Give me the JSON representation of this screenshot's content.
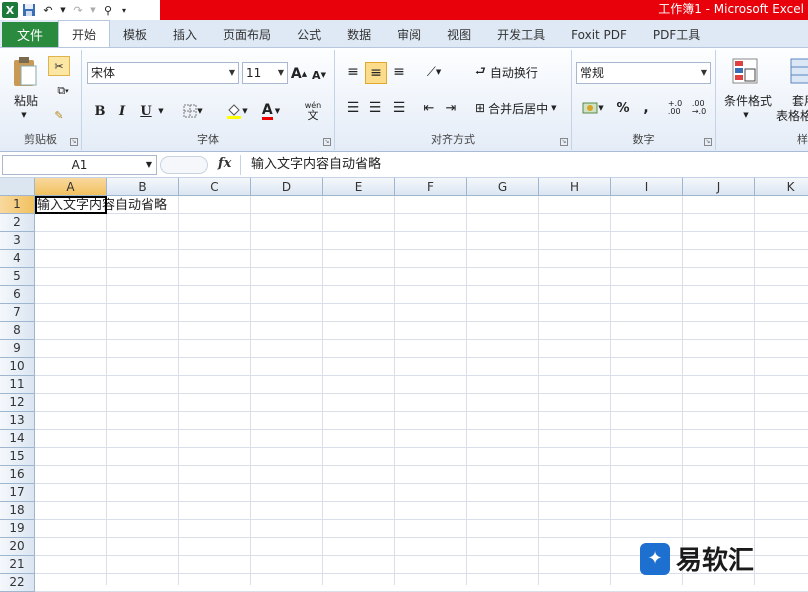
{
  "window": {
    "title": "工作簿1 - Microsoft Excel"
  },
  "ribbon_tabs": {
    "file": "文件",
    "tabs": [
      "开始",
      "模板",
      "插入",
      "页面布局",
      "公式",
      "数据",
      "审阅",
      "视图",
      "开发工具",
      "Foxit PDF",
      "PDF工具"
    ],
    "active": "开始"
  },
  "clipboard": {
    "paste": "粘贴",
    "label": "剪贴板"
  },
  "font": {
    "name": "宋体",
    "size": "11",
    "label": "字体",
    "bold": "B",
    "italic": "I",
    "underline": "U",
    "grow": "A",
    "shrink": "A",
    "color_letter": "A",
    "wen": "wén",
    "wen2": "文"
  },
  "align": {
    "wrap": "自动换行",
    "merge": "合并后居中",
    "label": "对齐方式"
  },
  "number": {
    "format": "常规",
    "percent": "%",
    "comma": ",",
    "inc": "+.0\n.00",
    "dec": ".00\n→.0",
    "label": "数字"
  },
  "styles": {
    "conditional": "条件格式",
    "table": "套用",
    "table2": "表格格",
    "label2": "样"
  },
  "formula_bar": {
    "name_box": "A1",
    "fx": "fx",
    "content": "输入文字内容自动省略"
  },
  "columns": [
    "A",
    "B",
    "C",
    "D",
    "E",
    "F",
    "G",
    "H",
    "I",
    "J",
    "K"
  ],
  "rows": [
    "1",
    "2",
    "3",
    "4",
    "5",
    "6",
    "7",
    "8",
    "9",
    "10",
    "11",
    "12",
    "13",
    "14",
    "15",
    "16",
    "17",
    "18",
    "19",
    "20",
    "21",
    "22"
  ],
  "cell_A1": "输入文字内容自动省略",
  "watermark": {
    "text": "易软汇",
    "logo": "✦"
  },
  "colors": {
    "title_red": "#e8000b",
    "file_green": "#2a8a3e",
    "selected_header": "#f1c15f"
  }
}
